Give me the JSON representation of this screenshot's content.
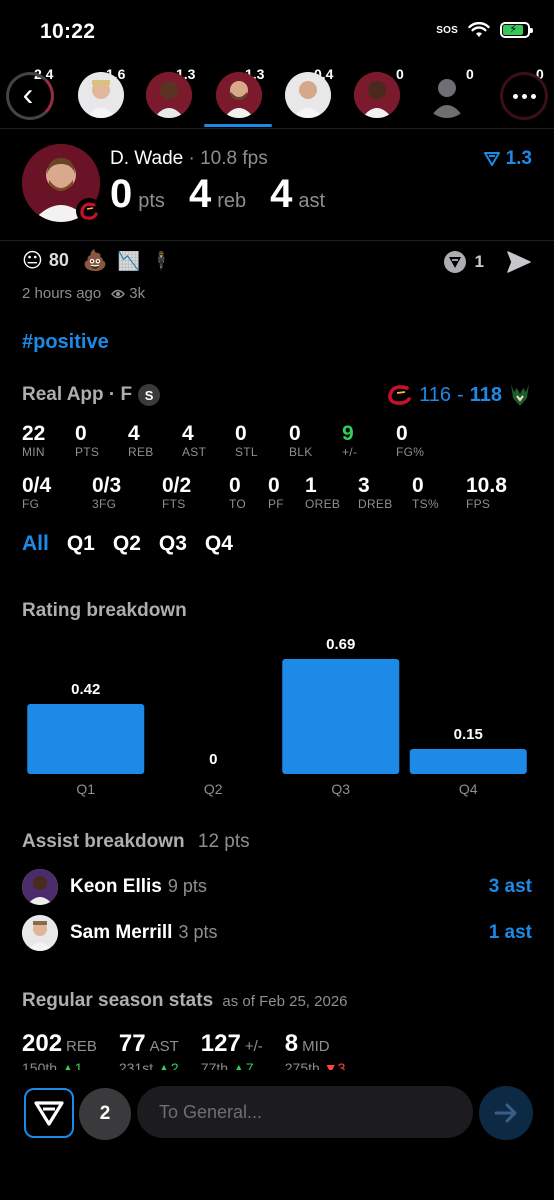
{
  "status_bar": {
    "time": "10:22",
    "signal": "SOS"
  },
  "carousel": {
    "items": [
      {
        "value": "2.4"
      },
      {
        "value": "1.6"
      },
      {
        "value": "1.3"
      },
      {
        "value": "1.3"
      },
      {
        "value": "0.4"
      },
      {
        "value": "0"
      },
      {
        "value": "0"
      },
      {
        "value": "0"
      }
    ]
  },
  "player": {
    "name": "D. Wade",
    "fps": "· 10.8 fps",
    "pts": "0",
    "pts_label": "pts",
    "reb": "4",
    "reb_label": "reb",
    "ast": "4",
    "ast_label": "ast",
    "rating": "1.3"
  },
  "reactions": {
    "count": "80",
    "vote_count": "1"
  },
  "meta": {
    "time_ago": "2 hours ago",
    "views": "3k"
  },
  "hashtag": "#positive",
  "game": {
    "title": "Real App · F",
    "badge": "S",
    "score_home": "116",
    "score_sep": "-",
    "score_away": "118",
    "row1": [
      {
        "v": "22",
        "l": "MIN"
      },
      {
        "v": "0",
        "l": "PTS"
      },
      {
        "v": "4",
        "l": "REB"
      },
      {
        "v": "4",
        "l": "AST"
      },
      {
        "v": "0",
        "l": "STL"
      },
      {
        "v": "0",
        "l": "BLK"
      },
      {
        "v": "9",
        "l": "+/-"
      },
      {
        "v": "0",
        "l": "FG%"
      }
    ],
    "row2": [
      {
        "v": "0/4",
        "l": "FG"
      },
      {
        "v": "0/3",
        "l": "3FG"
      },
      {
        "v": "0/2",
        "l": "FTS"
      },
      {
        "v": "0",
        "l": "TO"
      },
      {
        "v": "0",
        "l": "PF"
      },
      {
        "v": "1",
        "l": "OREB"
      },
      {
        "v": "3",
        "l": "DREB"
      },
      {
        "v": "0",
        "l": "TS%"
      },
      {
        "v": "10.8",
        "l": "FPS"
      }
    ],
    "tabs": [
      "All",
      "Q1",
      "Q2",
      "Q3",
      "Q4"
    ]
  },
  "rating_breakdown": {
    "title": "Rating breakdown"
  },
  "chart_data": {
    "type": "bar",
    "title": "Rating breakdown",
    "categories": [
      "Q1",
      "Q2",
      "Q3",
      "Q4"
    ],
    "values": [
      0.42,
      0,
      0.69,
      0.15
    ],
    "value_labels": [
      "0.42",
      "0",
      "0.69",
      "0.15"
    ],
    "color": "#1c8ae6",
    "ylim": [
      0,
      0.69
    ]
  },
  "assist": {
    "title": "Assist breakdown",
    "total": "12 pts",
    "rows": [
      {
        "name": "Keon Ellis",
        "pts": "9 pts",
        "ast": "3 ast"
      },
      {
        "name": "Sam Merrill",
        "pts": "3 pts",
        "ast": "1 ast"
      }
    ]
  },
  "season": {
    "title": "Regular season stats",
    "as_of": "as of Feb 25, 2026",
    "stats": [
      {
        "n": "202",
        "u": "REB",
        "rank": "150th",
        "delta": "1",
        "dir": "up"
      },
      {
        "n": "77",
        "u": "AST",
        "rank": "231st",
        "delta": "2",
        "dir": "up"
      },
      {
        "n": "127",
        "u": "+/-",
        "rank": "77th",
        "delta": "7",
        "dir": "up"
      },
      {
        "n": "8",
        "u": "MID",
        "rank": "275th",
        "delta": "3",
        "dir": "down"
      }
    ]
  },
  "composer": {
    "count": "2",
    "placeholder": "To General..."
  },
  "colors": {
    "accent": "#1c8ae6",
    "positive": "#30d158",
    "negative": "#ff453a",
    "team": "#6b1326"
  }
}
